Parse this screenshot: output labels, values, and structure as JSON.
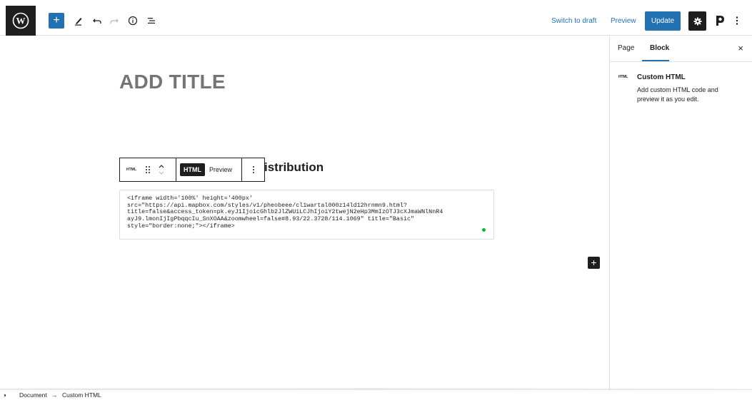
{
  "header": {
    "add_block_icon": "plus-icon",
    "tools": [
      "pencil-icon",
      "undo-icon",
      "redo-icon",
      "info-icon",
      "list-view-icon"
    ],
    "switch_to_draft": "Switch to draft",
    "preview": "Preview",
    "update": "Update",
    "accent_color": "#2271b1"
  },
  "editor": {
    "title": "ADD TITLE",
    "block_toolbar": {
      "type_label": "HTML",
      "tab_html": "HTML",
      "tab_preview": "Preview"
    },
    "heading_partial": "istribution",
    "code": "<iframe width='100%' height='400px'\nsrc=\"https://api.mapbox.com/styles/v1/pheobeee/cl1wartal000z14ld12hrnmn9.html?\ntitle=false&access_token=pk.eyJ1IjoicGhlb2JlZWUiLCJhIjoiY2twejN2eHp3MmIzOTJ3cXJmaWNlNnR4\nayJ9.lmonIjIgPbqqcIu_SnXOAA&zoomwheel=false#8.93/22.3728/114.1069\" title=\"Basic\"\nstyle=\"border:none;\"></iframe>"
  },
  "sidebar": {
    "tab_page": "Page",
    "tab_block": "Block",
    "close": "×",
    "block_icon_label": "HTML",
    "block_title": "Custom HTML",
    "block_description": "Add custom HTML code and preview it as you edit."
  },
  "breadcrumb": {
    "document": "Document",
    "arrow": "→",
    "current": "Custom HTML"
  }
}
